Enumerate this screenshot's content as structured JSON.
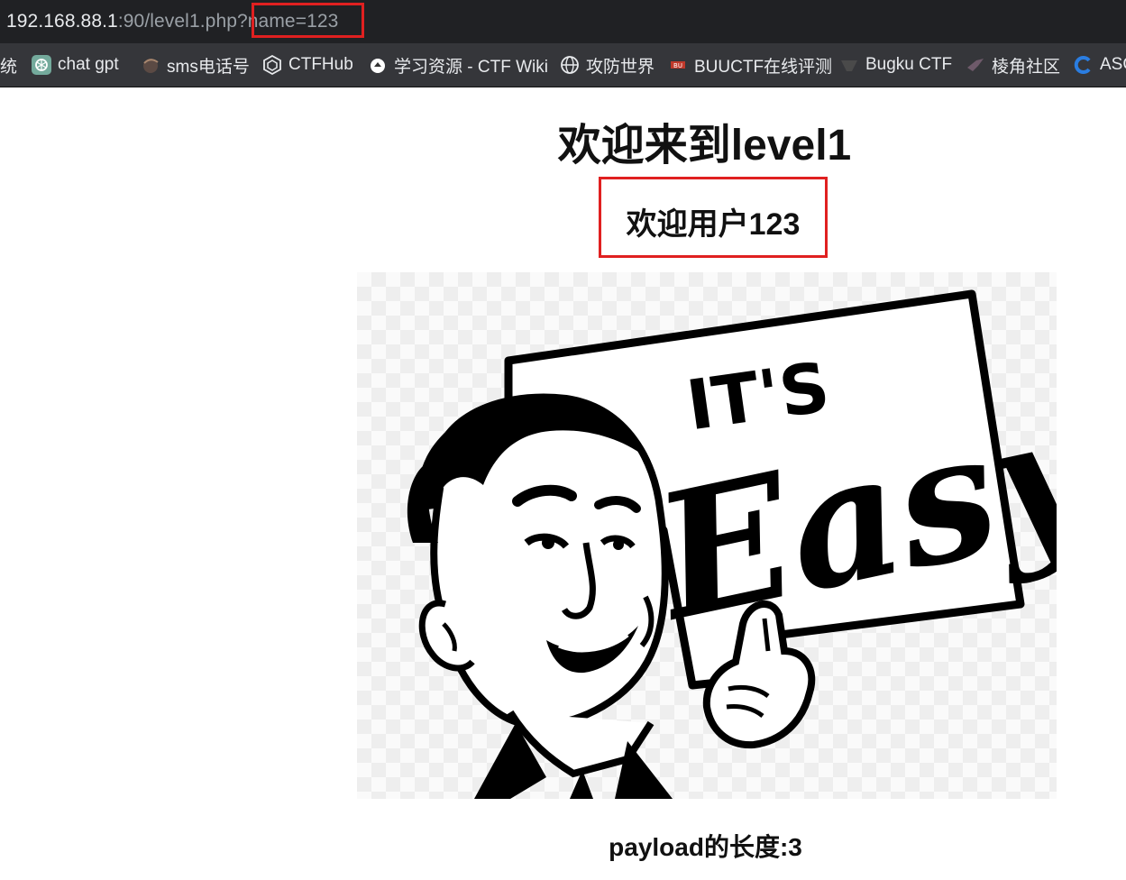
{
  "address_bar": {
    "host": "192.168.88.1",
    "path": ":90/level1.php?",
    "query": "name=123"
  },
  "bookmarks": [
    {
      "label": "统",
      "icon": "none"
    },
    {
      "label": "chat gpt",
      "icon": "openai-icon"
    },
    {
      "label": "sms电话号",
      "icon": "sms-icon"
    },
    {
      "label": "CTFHub",
      "icon": "ctfhub-icon"
    },
    {
      "label": "学习资源 - CTF Wiki",
      "icon": "ctf-wiki-icon"
    },
    {
      "label": "攻防世界",
      "icon": "globe-icon"
    },
    {
      "label": "BUUCTF在线评测",
      "icon": "buuctf-icon"
    },
    {
      "label": "Bugku CTF",
      "icon": "bugku-icon"
    },
    {
      "label": "棱角社区",
      "icon": "bird-icon"
    },
    {
      "label": "ASC",
      "icon": "c-logo-icon"
    }
  ],
  "page": {
    "title": "欢迎来到level1",
    "greeting": "欢迎用户123",
    "image_text_top": "IT'S",
    "image_text_script": "Easy",
    "payload_length": "payload的长度:3"
  },
  "colors": {
    "highlight": "#e02020",
    "address_bg": "#202124",
    "bookmarks_bg": "#35363a"
  }
}
